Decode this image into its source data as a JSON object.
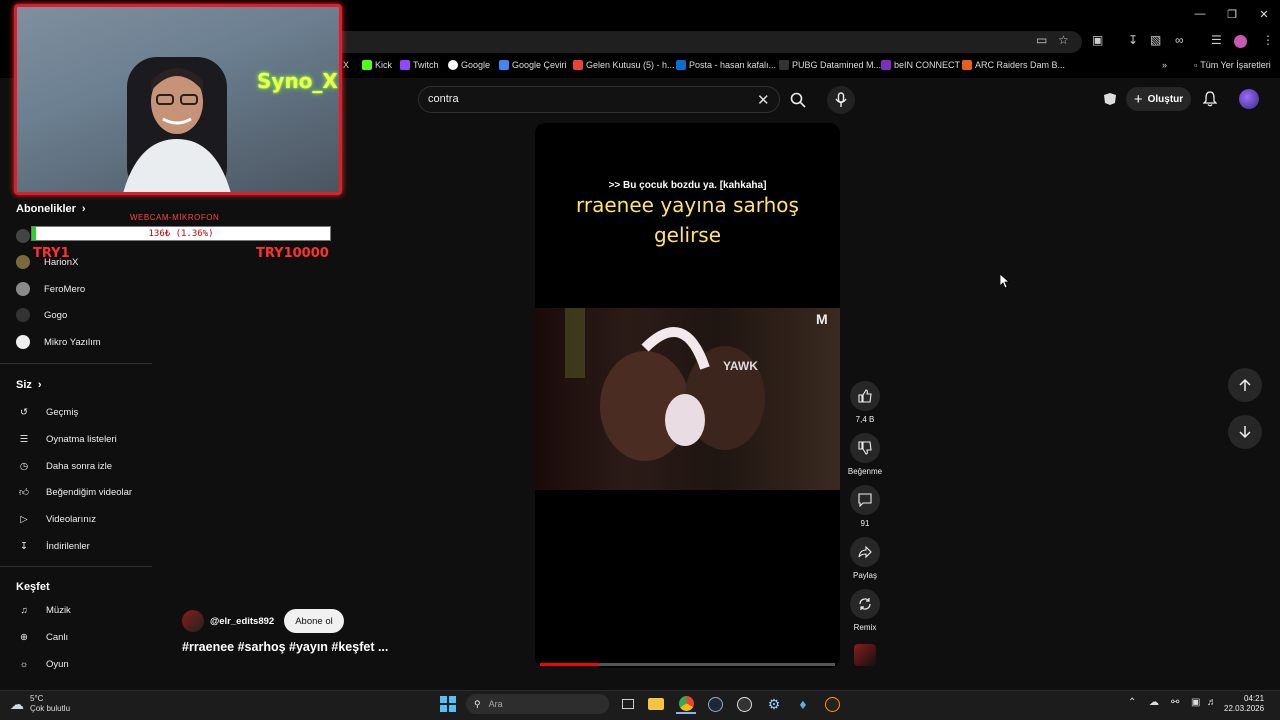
{
  "browser": {
    "bookmarks": [
      {
        "label": "X",
        "color": "#000000"
      },
      {
        "label": "Kick",
        "color": "#53fc18"
      },
      {
        "label": "Twitch",
        "color": "#9146ff"
      },
      {
        "label": "Google",
        "color": "#4285f4"
      },
      {
        "label": "Google Çeviri",
        "color": "#4285f4"
      },
      {
        "label": "Gelen Kutusu (5) - h...",
        "color": "#ea4335"
      },
      {
        "label": "Posta - hasan kafalı...",
        "color": "#0a6ed1"
      },
      {
        "label": "PUBG Datamined M...",
        "color": "#333333"
      },
      {
        "label": "beIN CONNECT",
        "color": "#7b2fbf"
      },
      {
        "label": "ARC Raiders Dam B...",
        "color": "#e85d20"
      }
    ],
    "all_bookmarks": "Tüm Yer İşaretleri"
  },
  "search": {
    "query": "contra"
  },
  "header": {
    "create_label": "Oluştur"
  },
  "overlay": {
    "webcam_sign": "Syno_X",
    "donation_label": "WEBCAM-MİKROFON",
    "donation_text": "136₺ (1.36%)",
    "donation_progress": 0.0136,
    "donation_min": "TRY1",
    "donation_max": "TRY10000"
  },
  "sidebar": {
    "subscriptions_title": "Abonelikler",
    "subscriptions": [
      {
        "name": "HarionX"
      },
      {
        "name": "FeroMero"
      },
      {
        "name": "Gogo"
      },
      {
        "name": "Mikro Yazılım"
      }
    ],
    "you_title": "Siz",
    "you_items": [
      {
        "label": "Geçmiş",
        "icon": "history-icon"
      },
      {
        "label": "Oynatma listeleri",
        "icon": "playlist-icon"
      },
      {
        "label": "Daha sonra izle",
        "icon": "clock-icon"
      },
      {
        "label": "Beğendiğim videolar",
        "icon": "thumbs-up-icon"
      },
      {
        "label": "Videolarınız",
        "icon": "video-icon"
      },
      {
        "label": "İndirilenler",
        "icon": "download-icon"
      }
    ],
    "explore_title": "Keşfet",
    "explore_items": [
      {
        "label": "Müzik",
        "icon": "music-icon"
      },
      {
        "label": "Canlı",
        "icon": "live-icon"
      },
      {
        "label": "Oyun",
        "icon": "gaming-icon"
      }
    ]
  },
  "short": {
    "caption_small": ">> Bu çocuk bozdu ya. [kahkaha]",
    "caption_big": "rraenee yayına sarhoş gelirse",
    "progress": 0.2,
    "likes": "7,4 B",
    "dislike_label": "Beğenme",
    "comments": "91",
    "share_label": "Paylaş",
    "remix_label": "Remix",
    "channel": "@elr_edits892",
    "subscribe_label": "Abone ol",
    "title": "#rraenee #sarhoş #yayın #keşfet ..."
  },
  "taskbar": {
    "weather_temp": "5°C",
    "weather_desc": "Çok bulutlu",
    "search_placeholder": "Ara",
    "time": "04:21",
    "date": "22.03.2026"
  }
}
